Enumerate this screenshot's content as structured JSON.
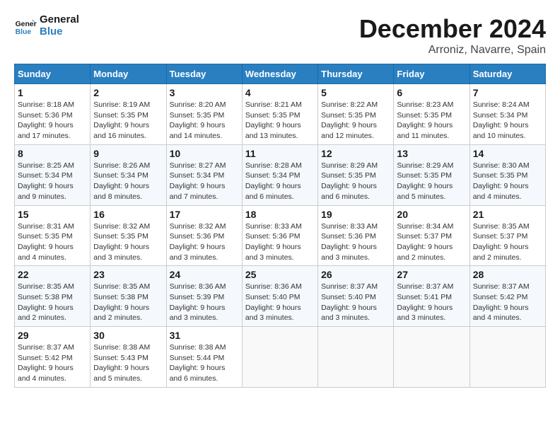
{
  "header": {
    "logo_general": "General",
    "logo_blue": "Blue",
    "month_title": "December 2024",
    "subtitle": "Arroniz, Navarre, Spain"
  },
  "calendar": {
    "days_of_week": [
      "Sunday",
      "Monday",
      "Tuesday",
      "Wednesday",
      "Thursday",
      "Friday",
      "Saturday"
    ],
    "weeks": [
      [
        {
          "day": "1",
          "sunrise": "8:18 AM",
          "sunset": "5:36 PM",
          "daylight": "9 hours and 17 minutes."
        },
        {
          "day": "2",
          "sunrise": "8:19 AM",
          "sunset": "5:35 PM",
          "daylight": "9 hours and 16 minutes."
        },
        {
          "day": "3",
          "sunrise": "8:20 AM",
          "sunset": "5:35 PM",
          "daylight": "9 hours and 14 minutes."
        },
        {
          "day": "4",
          "sunrise": "8:21 AM",
          "sunset": "5:35 PM",
          "daylight": "9 hours and 13 minutes."
        },
        {
          "day": "5",
          "sunrise": "8:22 AM",
          "sunset": "5:35 PM",
          "daylight": "9 hours and 12 minutes."
        },
        {
          "day": "6",
          "sunrise": "8:23 AM",
          "sunset": "5:35 PM",
          "daylight": "9 hours and 11 minutes."
        },
        {
          "day": "7",
          "sunrise": "8:24 AM",
          "sunset": "5:34 PM",
          "daylight": "9 hours and 10 minutes."
        }
      ],
      [
        {
          "day": "8",
          "sunrise": "8:25 AM",
          "sunset": "5:34 PM",
          "daylight": "9 hours and 9 minutes."
        },
        {
          "day": "9",
          "sunrise": "8:26 AM",
          "sunset": "5:34 PM",
          "daylight": "9 hours and 8 minutes."
        },
        {
          "day": "10",
          "sunrise": "8:27 AM",
          "sunset": "5:34 PM",
          "daylight": "9 hours and 7 minutes."
        },
        {
          "day": "11",
          "sunrise": "8:28 AM",
          "sunset": "5:34 PM",
          "daylight": "9 hours and 6 minutes."
        },
        {
          "day": "12",
          "sunrise": "8:29 AM",
          "sunset": "5:35 PM",
          "daylight": "9 hours and 6 minutes."
        },
        {
          "day": "13",
          "sunrise": "8:29 AM",
          "sunset": "5:35 PM",
          "daylight": "9 hours and 5 minutes."
        },
        {
          "day": "14",
          "sunrise": "8:30 AM",
          "sunset": "5:35 PM",
          "daylight": "9 hours and 4 minutes."
        }
      ],
      [
        {
          "day": "15",
          "sunrise": "8:31 AM",
          "sunset": "5:35 PM",
          "daylight": "9 hours and 4 minutes."
        },
        {
          "day": "16",
          "sunrise": "8:32 AM",
          "sunset": "5:35 PM",
          "daylight": "9 hours and 3 minutes."
        },
        {
          "day": "17",
          "sunrise": "8:32 AM",
          "sunset": "5:36 PM",
          "daylight": "9 hours and 3 minutes."
        },
        {
          "day": "18",
          "sunrise": "8:33 AM",
          "sunset": "5:36 PM",
          "daylight": "9 hours and 3 minutes."
        },
        {
          "day": "19",
          "sunrise": "8:33 AM",
          "sunset": "5:36 PM",
          "daylight": "9 hours and 3 minutes."
        },
        {
          "day": "20",
          "sunrise": "8:34 AM",
          "sunset": "5:37 PM",
          "daylight": "9 hours and 2 minutes."
        },
        {
          "day": "21",
          "sunrise": "8:35 AM",
          "sunset": "5:37 PM",
          "daylight": "9 hours and 2 minutes."
        }
      ],
      [
        {
          "day": "22",
          "sunrise": "8:35 AM",
          "sunset": "5:38 PM",
          "daylight": "9 hours and 2 minutes."
        },
        {
          "day": "23",
          "sunrise": "8:35 AM",
          "sunset": "5:38 PM",
          "daylight": "9 hours and 2 minutes."
        },
        {
          "day": "24",
          "sunrise": "8:36 AM",
          "sunset": "5:39 PM",
          "daylight": "9 hours and 3 minutes."
        },
        {
          "day": "25",
          "sunrise": "8:36 AM",
          "sunset": "5:40 PM",
          "daylight": "9 hours and 3 minutes."
        },
        {
          "day": "26",
          "sunrise": "8:37 AM",
          "sunset": "5:40 PM",
          "daylight": "9 hours and 3 minutes."
        },
        {
          "day": "27",
          "sunrise": "8:37 AM",
          "sunset": "5:41 PM",
          "daylight": "9 hours and 3 minutes."
        },
        {
          "day": "28",
          "sunrise": "8:37 AM",
          "sunset": "5:42 PM",
          "daylight": "9 hours and 4 minutes."
        }
      ],
      [
        {
          "day": "29",
          "sunrise": "8:37 AM",
          "sunset": "5:42 PM",
          "daylight": "9 hours and 4 minutes."
        },
        {
          "day": "30",
          "sunrise": "8:38 AM",
          "sunset": "5:43 PM",
          "daylight": "9 hours and 5 minutes."
        },
        {
          "day": "31",
          "sunrise": "8:38 AM",
          "sunset": "5:44 PM",
          "daylight": "9 hours and 6 minutes."
        },
        null,
        null,
        null,
        null
      ]
    ]
  }
}
